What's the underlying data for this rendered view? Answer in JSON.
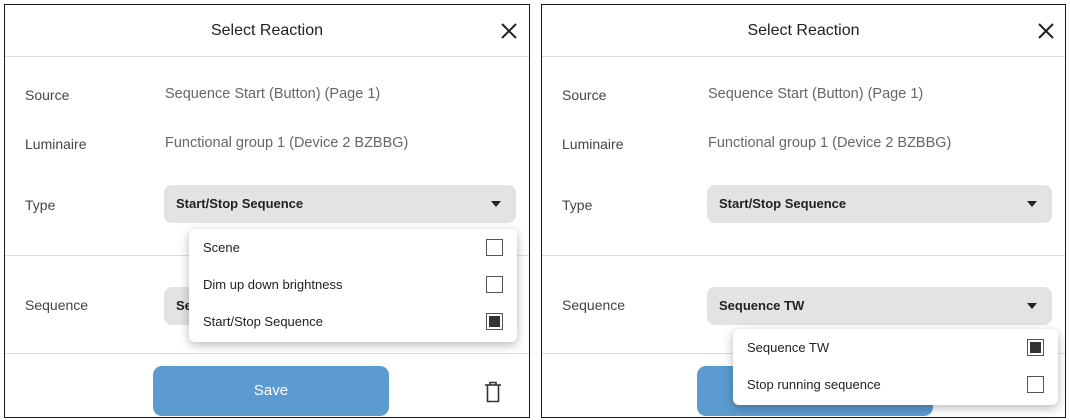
{
  "left": {
    "header": {
      "title": "Select Reaction"
    },
    "fields": {
      "source_label": "Source",
      "source_value": "Sequence Start (Button) (Page 1)",
      "luminaire_label": "Luminaire",
      "luminaire_value": "Functional group 1 (Device 2 BZBBG)",
      "type_label": "Type",
      "type_selected": "Start/Stop Sequence",
      "sequence_label": "Sequence",
      "sequence_selected_partial": "Se"
    },
    "type_dropdown": {
      "options": [
        {
          "label": "Scene",
          "checked": false
        },
        {
          "label": "Dim up down brightness",
          "checked": false
        },
        {
          "label": "Start/Stop Sequence",
          "checked": true
        }
      ]
    },
    "footer": {
      "save_label": "Save"
    }
  },
  "right": {
    "header": {
      "title": "Select Reaction"
    },
    "fields": {
      "source_label": "Source",
      "source_value": "Sequence Start (Button) (Page 1)",
      "luminaire_label": "Luminaire",
      "luminaire_value": "Functional group 1 (Device 2 BZBBG)",
      "type_label": "Type",
      "type_selected": "Start/Stop Sequence",
      "sequence_label": "Sequence",
      "sequence_selected": "Sequence TW"
    },
    "sequence_dropdown": {
      "options": [
        {
          "label": "Sequence TW",
          "checked": true
        },
        {
          "label": "Stop running sequence",
          "checked": false
        }
      ]
    }
  },
  "icons": {
    "close": "close-icon",
    "delete": "trash-icon",
    "dropdown": "caret-down-icon",
    "checkbox": "checkbox-icon"
  },
  "colors": {
    "save_button": "#5b9bd0",
    "select_bg": "#e3e3e3",
    "divider": "#dcdcdc"
  }
}
